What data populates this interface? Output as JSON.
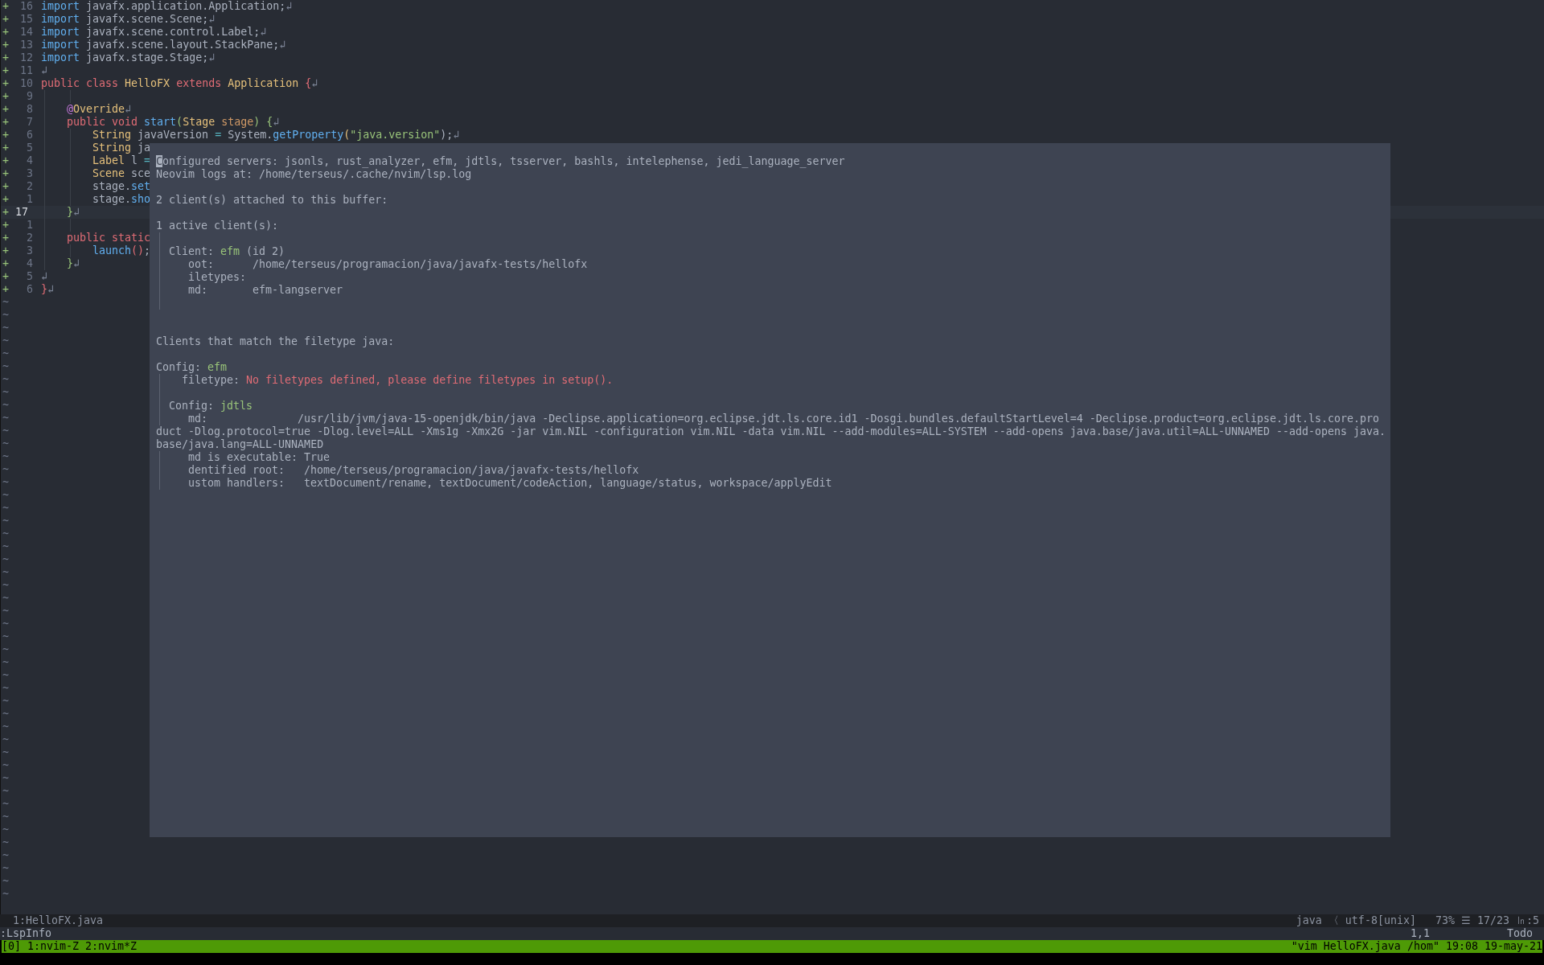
{
  "editor": {
    "empty_line_marker": "~",
    "lines": [
      {
        "sign": "+",
        "number": "16",
        "current": false,
        "tokens": [
          {
            "text": "import",
            "kind": "include"
          },
          {
            "text": " javafx.application.Application;",
            "kind": "plain"
          },
          {
            "text": "↲",
            "kind": "eol"
          }
        ]
      },
      {
        "sign": "+",
        "number": "15",
        "current": false,
        "tokens": [
          {
            "text": "import",
            "kind": "include"
          },
          {
            "text": " javafx.scene.Scene;",
            "kind": "plain"
          },
          {
            "text": "↲",
            "kind": "eol"
          }
        ]
      },
      {
        "sign": "+",
        "number": "14",
        "current": false,
        "tokens": [
          {
            "text": "import",
            "kind": "include"
          },
          {
            "text": " javafx.scene.control.Label;",
            "kind": "plain"
          },
          {
            "text": "↲",
            "kind": "eol"
          }
        ]
      },
      {
        "sign": "+",
        "number": "13",
        "current": false,
        "tokens": [
          {
            "text": "import",
            "kind": "include"
          },
          {
            "text": " javafx.scene.layout.StackPane;",
            "kind": "plain"
          },
          {
            "text": "↲",
            "kind": "eol"
          }
        ]
      },
      {
        "sign": "+",
        "number": "12",
        "current": false,
        "tokens": [
          {
            "text": "import",
            "kind": "include"
          },
          {
            "text": " javafx.stage.Stage;",
            "kind": "plain"
          },
          {
            "text": "↲",
            "kind": "eol"
          }
        ]
      },
      {
        "sign": "+",
        "number": "11",
        "current": false,
        "tokens": [
          {
            "text": "↲",
            "kind": "eol"
          }
        ]
      },
      {
        "sign": "+",
        "number": "10",
        "current": false,
        "tokens": [
          {
            "text": "public class",
            "kind": "keyword"
          },
          {
            "text": " HelloFX",
            "kind": "type"
          },
          {
            "text": " extends",
            "kind": "keyword"
          },
          {
            "text": " Application",
            "kind": "type"
          },
          {
            "text": " {",
            "kind": "keyword"
          },
          {
            "text": "↲",
            "kind": "eol"
          }
        ]
      },
      {
        "sign": "+",
        "number": "9",
        "current": false,
        "tokens": [
          {
            "kind": "indent"
          },
          {
            "kind": "indent"
          }
        ]
      },
      {
        "sign": "+",
        "number": "8",
        "current": false,
        "tokens": [
          {
            "kind": "indent"
          },
          {
            "text": "@",
            "kind": "decorator"
          },
          {
            "text": "Override",
            "kind": "type"
          },
          {
            "text": "↲",
            "kind": "eol"
          }
        ]
      },
      {
        "sign": "+",
        "number": "7",
        "current": false,
        "tokens": [
          {
            "kind": "indent"
          },
          {
            "text": "public void",
            "kind": "keyword"
          },
          {
            "text": " start",
            "kind": "function"
          },
          {
            "text": "(",
            "kind": "bracket"
          },
          {
            "text": "Stage",
            "kind": "type"
          },
          {
            "text": " stage",
            "kind": "param"
          },
          {
            "text": ")",
            "kind": "bracket"
          },
          {
            "text": " {",
            "kind": "bracket"
          },
          {
            "text": "↲",
            "kind": "eol"
          }
        ]
      },
      {
        "sign": "+",
        "number": "6",
        "current": false,
        "tokens": [
          {
            "kind": "indent"
          },
          {
            "kind": "indent"
          },
          {
            "text": "String",
            "kind": "type"
          },
          {
            "text": " javaVersion ",
            "kind": "plain"
          },
          {
            "text": "=",
            "kind": "operator"
          },
          {
            "text": " System.",
            "kind": "plain"
          },
          {
            "text": "getProperty",
            "kind": "function"
          },
          {
            "text": "(",
            "kind": "type"
          },
          {
            "text": "\"java.version\"",
            "kind": "string"
          },
          {
            "text": ");",
            "kind": "plain"
          },
          {
            "text": "↲",
            "kind": "eol"
          }
        ]
      },
      {
        "sign": "+",
        "number": "5",
        "current": false,
        "tokens": [
          {
            "kind": "indent"
          },
          {
            "kind": "indent"
          },
          {
            "text": "String",
            "kind": "type"
          },
          {
            "text": " ja",
            "kind": "plain"
          }
        ]
      },
      {
        "sign": "+",
        "number": "4",
        "current": false,
        "tokens": [
          {
            "kind": "indent"
          },
          {
            "kind": "indent"
          },
          {
            "text": "Label",
            "kind": "type"
          },
          {
            "text": " l ",
            "kind": "plain"
          },
          {
            "text": "=",
            "kind": "operator"
          }
        ]
      },
      {
        "sign": "+",
        "number": "3",
        "current": false,
        "tokens": [
          {
            "kind": "indent"
          },
          {
            "kind": "indent"
          },
          {
            "text": "Scene",
            "kind": "type"
          },
          {
            "text": " sce",
            "kind": "plain"
          }
        ]
      },
      {
        "sign": "+",
        "number": "2",
        "current": false,
        "tokens": [
          {
            "kind": "indent"
          },
          {
            "kind": "indent"
          },
          {
            "text": "stage.",
            "kind": "plain"
          },
          {
            "text": "set",
            "kind": "function"
          }
        ]
      },
      {
        "sign": "+",
        "number": "1",
        "current": false,
        "tokens": [
          {
            "kind": "indent"
          },
          {
            "kind": "indent"
          },
          {
            "text": "stage.",
            "kind": "plain"
          },
          {
            "text": "sho",
            "kind": "function"
          }
        ]
      },
      {
        "sign": "+",
        "number": "17",
        "current": true,
        "tokens": [
          {
            "kind": "indent"
          },
          {
            "text": "}",
            "kind": "bracket"
          },
          {
            "text": "↲",
            "kind": "eol"
          }
        ]
      },
      {
        "sign": "+",
        "number": "1",
        "current": false,
        "tokens": [
          {
            "kind": "indent"
          },
          {
            "kind": "indent"
          }
        ]
      },
      {
        "sign": "+",
        "number": "2",
        "current": false,
        "tokens": [
          {
            "kind": "indent"
          },
          {
            "text": "public static",
            "kind": "keyword"
          }
        ]
      },
      {
        "sign": "+",
        "number": "3",
        "current": false,
        "tokens": [
          {
            "kind": "indent"
          },
          {
            "kind": "indent"
          },
          {
            "text": "launch",
            "kind": "function"
          },
          {
            "text": "()",
            "kind": "keyword"
          },
          {
            "text": ";",
            "kind": "plain"
          }
        ]
      },
      {
        "sign": "+",
        "number": "4",
        "current": false,
        "tokens": [
          {
            "kind": "indent"
          },
          {
            "text": "}",
            "kind": "bracket"
          },
          {
            "text": "↲",
            "kind": "eol"
          }
        ]
      },
      {
        "sign": "+",
        "number": "5",
        "current": false,
        "tokens": [
          {
            "text": "↲",
            "kind": "eol"
          }
        ]
      },
      {
        "sign": "+",
        "number": "6",
        "current": false,
        "tokens": [
          {
            "text": "}",
            "kind": "keyword"
          },
          {
            "text": "↲",
            "kind": "eol"
          }
        ]
      }
    ]
  },
  "popup": {
    "lines": [
      {
        "kind": "top",
        "guide": false,
        "parts": [
          {
            "text": "C",
            "kind": "cursor"
          },
          {
            "text": "onfigured servers: jsonls, rust_analyzer, efm, jdtls, tsserver, bashls, intelephense, jedi_language_server",
            "kind": "plain"
          }
        ]
      },
      {
        "kind": "top",
        "guide": false,
        "parts": [
          {
            "text": "Neovim logs at: /home/terseus/.cache/nvim/lsp.log",
            "kind": "plain"
          }
        ]
      },
      {
        "kind": "blank",
        "guide": false
      },
      {
        "kind": "top",
        "guide": false,
        "parts": [
          {
            "text": "2 client(s) attached to this buffer:",
            "kind": "plain"
          }
        ]
      },
      {
        "kind": "blank",
        "guide": false
      },
      {
        "kind": "top",
        "guide": false,
        "parts": [
          {
            "text": "1 active client(s):",
            "kind": "plain"
          }
        ]
      },
      {
        "kind": "blank",
        "guide": true
      },
      {
        "kind": "block",
        "guide": true,
        "parts": [
          {
            "text": "Client: ",
            "kind": "plain"
          },
          {
            "text": "efm",
            "kind": "name"
          },
          {
            "text": " (id 2)",
            "kind": "plain"
          }
        ]
      },
      {
        "kind": "field",
        "guide": true,
        "parts": [
          {
            "text": "oot:      /home/terseus/programacion/java/javafx-tests/hellofx",
            "kind": "plain"
          }
        ]
      },
      {
        "kind": "field",
        "guide": true,
        "parts": [
          {
            "text": "iletypes:",
            "kind": "plain"
          }
        ]
      },
      {
        "kind": "field",
        "guide": true,
        "parts": [
          {
            "text": "md:       efm-langserver",
            "kind": "plain"
          }
        ]
      },
      {
        "kind": "blank",
        "guide": true
      },
      {
        "kind": "blank",
        "guide": false
      },
      {
        "kind": "blank",
        "guide": false
      },
      {
        "kind": "top",
        "guide": false,
        "parts": [
          {
            "text": "Clients that match the filetype java:",
            "kind": "plain"
          }
        ]
      },
      {
        "kind": "blank",
        "guide": false
      },
      {
        "kind": "top",
        "guide": false,
        "parts": [
          {
            "text": "Config: ",
            "kind": "plain"
          },
          {
            "text": "efm",
            "kind": "name"
          }
        ]
      },
      {
        "kind": "detail",
        "guide": true,
        "parts": [
          {
            "text": "filetype: ",
            "kind": "plain"
          },
          {
            "text": "No filetypes defined, please define filetypes in setup().",
            "kind": "error"
          }
        ]
      },
      {
        "kind": "blank",
        "guide": true
      },
      {
        "kind": "block",
        "guide": true,
        "parts": [
          {
            "text": "Config: ",
            "kind": "plain"
          },
          {
            "text": "jdtls",
            "kind": "name"
          }
        ]
      },
      {
        "kind": "field",
        "guide": true,
        "parts": [
          {
            "text": "md:              /usr/lib/jvm/java-15-openjdk/bin/java -Declipse.application=org.eclipse.jdt.ls.core.id1 -Dosgi.bundles.defaultStartLevel=4 -Declipse.product=org.eclipse.jdt.ls.core.pro",
            "kind": "plain"
          }
        ]
      },
      {
        "kind": "top",
        "guide": false,
        "parts": [
          {
            "text": "duct -Dlog.protocol=true -Dlog.level=ALL -Xms1g -Xmx2G -jar vim.NIL -configuration vim.NIL -data vim.NIL --add-modules=ALL-SYSTEM --add-opens java.base/java.util=ALL-UNNAMED --add-opens java.",
            "kind": "plain"
          }
        ]
      },
      {
        "kind": "top",
        "guide": false,
        "parts": [
          {
            "text": "base/java.lang=ALL-UNNAMED",
            "kind": "plain"
          }
        ]
      },
      {
        "kind": "field",
        "guide": true,
        "parts": [
          {
            "text": "md is executable: True",
            "kind": "plain"
          }
        ]
      },
      {
        "kind": "field",
        "guide": true,
        "parts": [
          {
            "text": "dentified root:   /home/terseus/programacion/java/javafx-tests/hellofx",
            "kind": "plain"
          }
        ]
      },
      {
        "kind": "field",
        "guide": true,
        "parts": [
          {
            "text": "ustom handlers:   textDocument/rename, textDocument/codeAction, language/status, workspace/applyEdit",
            "kind": "plain"
          }
        ]
      }
    ]
  },
  "status_bar": {
    "file": "1:HelloFX.java",
    "filetype": "java 〈 utf-8[unix]",
    "position": "73% ☰ 17/23 ㏑:5"
  },
  "command_line": {
    "command": ":LspInfo",
    "cursor": "1,1",
    "scroll": "Todo"
  },
  "tmux_bar": {
    "windows": "[0] 1:nvim-Z 2:nvim*Z",
    "info": "\"vim HelloFX.java /hom\" 19:08 19-may-21"
  }
}
